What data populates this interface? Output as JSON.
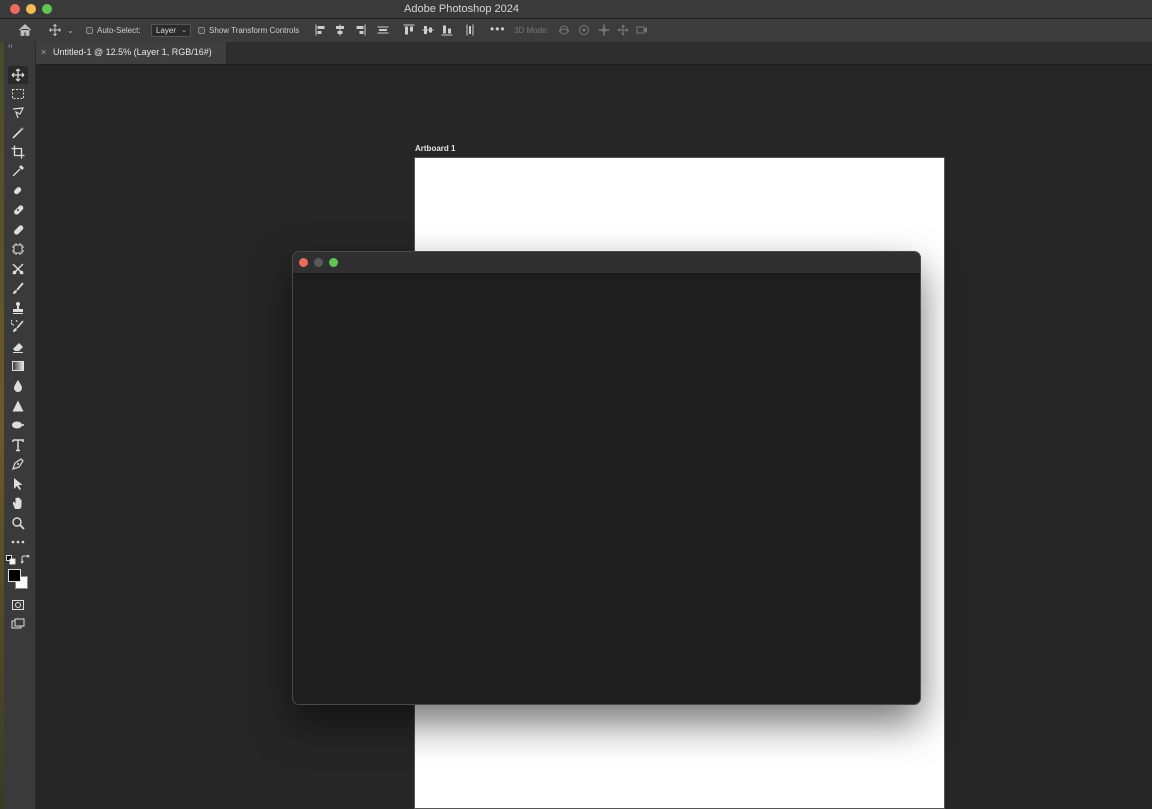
{
  "app": {
    "title": "Adobe Photoshop 2024"
  },
  "options_bar": {
    "auto_select_label": "Auto-Select:",
    "auto_select_target": "Layer",
    "show_transform_label": "Show Transform Controls",
    "mode_3d_label": "3D Mode:"
  },
  "document": {
    "tab_label": "Untitled-1 @ 12.5% (Layer 1, RGB/16#)",
    "tab_close": "×",
    "artboard_label": "Artboard 1"
  },
  "toolbar": {
    "tools": [
      "move-tool",
      "rectangular-marquee-tool",
      "lasso-tool",
      "magic-wand-tool",
      "crop-tool",
      "eyedropper-tool",
      "spot-healing-tool",
      "healing-brush-tool",
      "patch-tool",
      "content-aware-move-tool",
      "red-eye-tool",
      "brush-tool",
      "clone-stamp-tool",
      "history-brush-tool",
      "eraser-tool",
      "gradient-tool",
      "blur-tool",
      "sharpen-tool",
      "smudge-tool",
      "type-tool",
      "pen-tool",
      "path-selection-tool",
      "hand-tool",
      "zoom-tool",
      "more-tools"
    ]
  },
  "colors": {
    "foreground": "#000000",
    "background": "#ffffff"
  }
}
